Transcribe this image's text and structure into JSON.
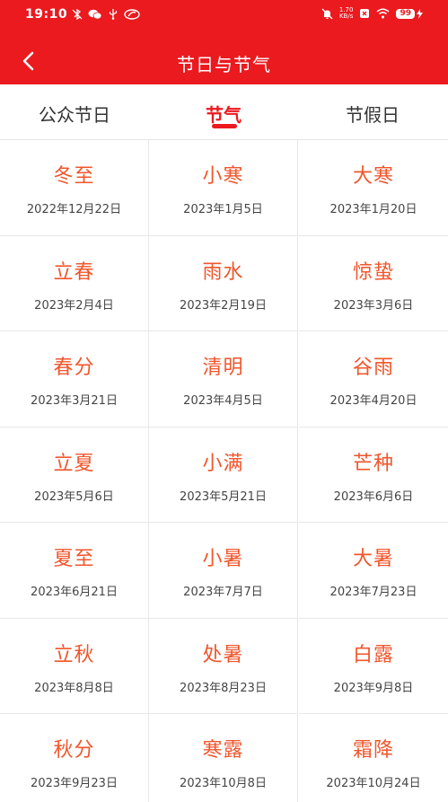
{
  "status_bar": {
    "time": "19:10",
    "net_speed_value": "1.70",
    "net_speed_unit": "KB/s",
    "battery": "99",
    "left_icons": [
      "bluetooth-off-icon",
      "wechat-icon",
      "usb-icon",
      "app-icon"
    ],
    "right_icons": [
      "mute-icon",
      "netspeed",
      "sim-x-icon",
      "wifi-icon",
      "battery-icon",
      "charging-icon"
    ]
  },
  "header": {
    "title": "节日与节气",
    "back_icon": "back-arrow-icon"
  },
  "tabs": [
    {
      "label": "公众节日",
      "active": false
    },
    {
      "label": "节气",
      "active": true
    },
    {
      "label": "节假日",
      "active": false
    }
  ],
  "solar_terms": [
    {
      "name": "冬至",
      "date": "2022年12月22日"
    },
    {
      "name": "小寒",
      "date": "2023年1月5日"
    },
    {
      "name": "大寒",
      "date": "2023年1月20日"
    },
    {
      "name": "立春",
      "date": "2023年2月4日"
    },
    {
      "name": "雨水",
      "date": "2023年2月19日"
    },
    {
      "name": "惊蛰",
      "date": "2023年3月6日"
    },
    {
      "name": "春分",
      "date": "2023年3月21日"
    },
    {
      "name": "清明",
      "date": "2023年4月5日"
    },
    {
      "name": "谷雨",
      "date": "2023年4月20日"
    },
    {
      "name": "立夏",
      "date": "2023年5月6日"
    },
    {
      "name": "小满",
      "date": "2023年5月21日"
    },
    {
      "name": "芒种",
      "date": "2023年6月6日"
    },
    {
      "name": "夏至",
      "date": "2023年6月21日"
    },
    {
      "name": "小暑",
      "date": "2023年7月7日"
    },
    {
      "name": "大暑",
      "date": "2023年7月23日"
    },
    {
      "name": "立秋",
      "date": "2023年8月8日"
    },
    {
      "name": "处暑",
      "date": "2023年8月23日"
    },
    {
      "name": "白露",
      "date": "2023年9月8日"
    },
    {
      "name": "秋分",
      "date": "2023年9月23日"
    },
    {
      "name": "寒露",
      "date": "2023年10月8日"
    },
    {
      "name": "霜降",
      "date": "2023年10月24日"
    }
  ],
  "colors": {
    "brand_red": "#ea1a1f",
    "term_name": "#f0562c",
    "date_text": "#444444"
  }
}
